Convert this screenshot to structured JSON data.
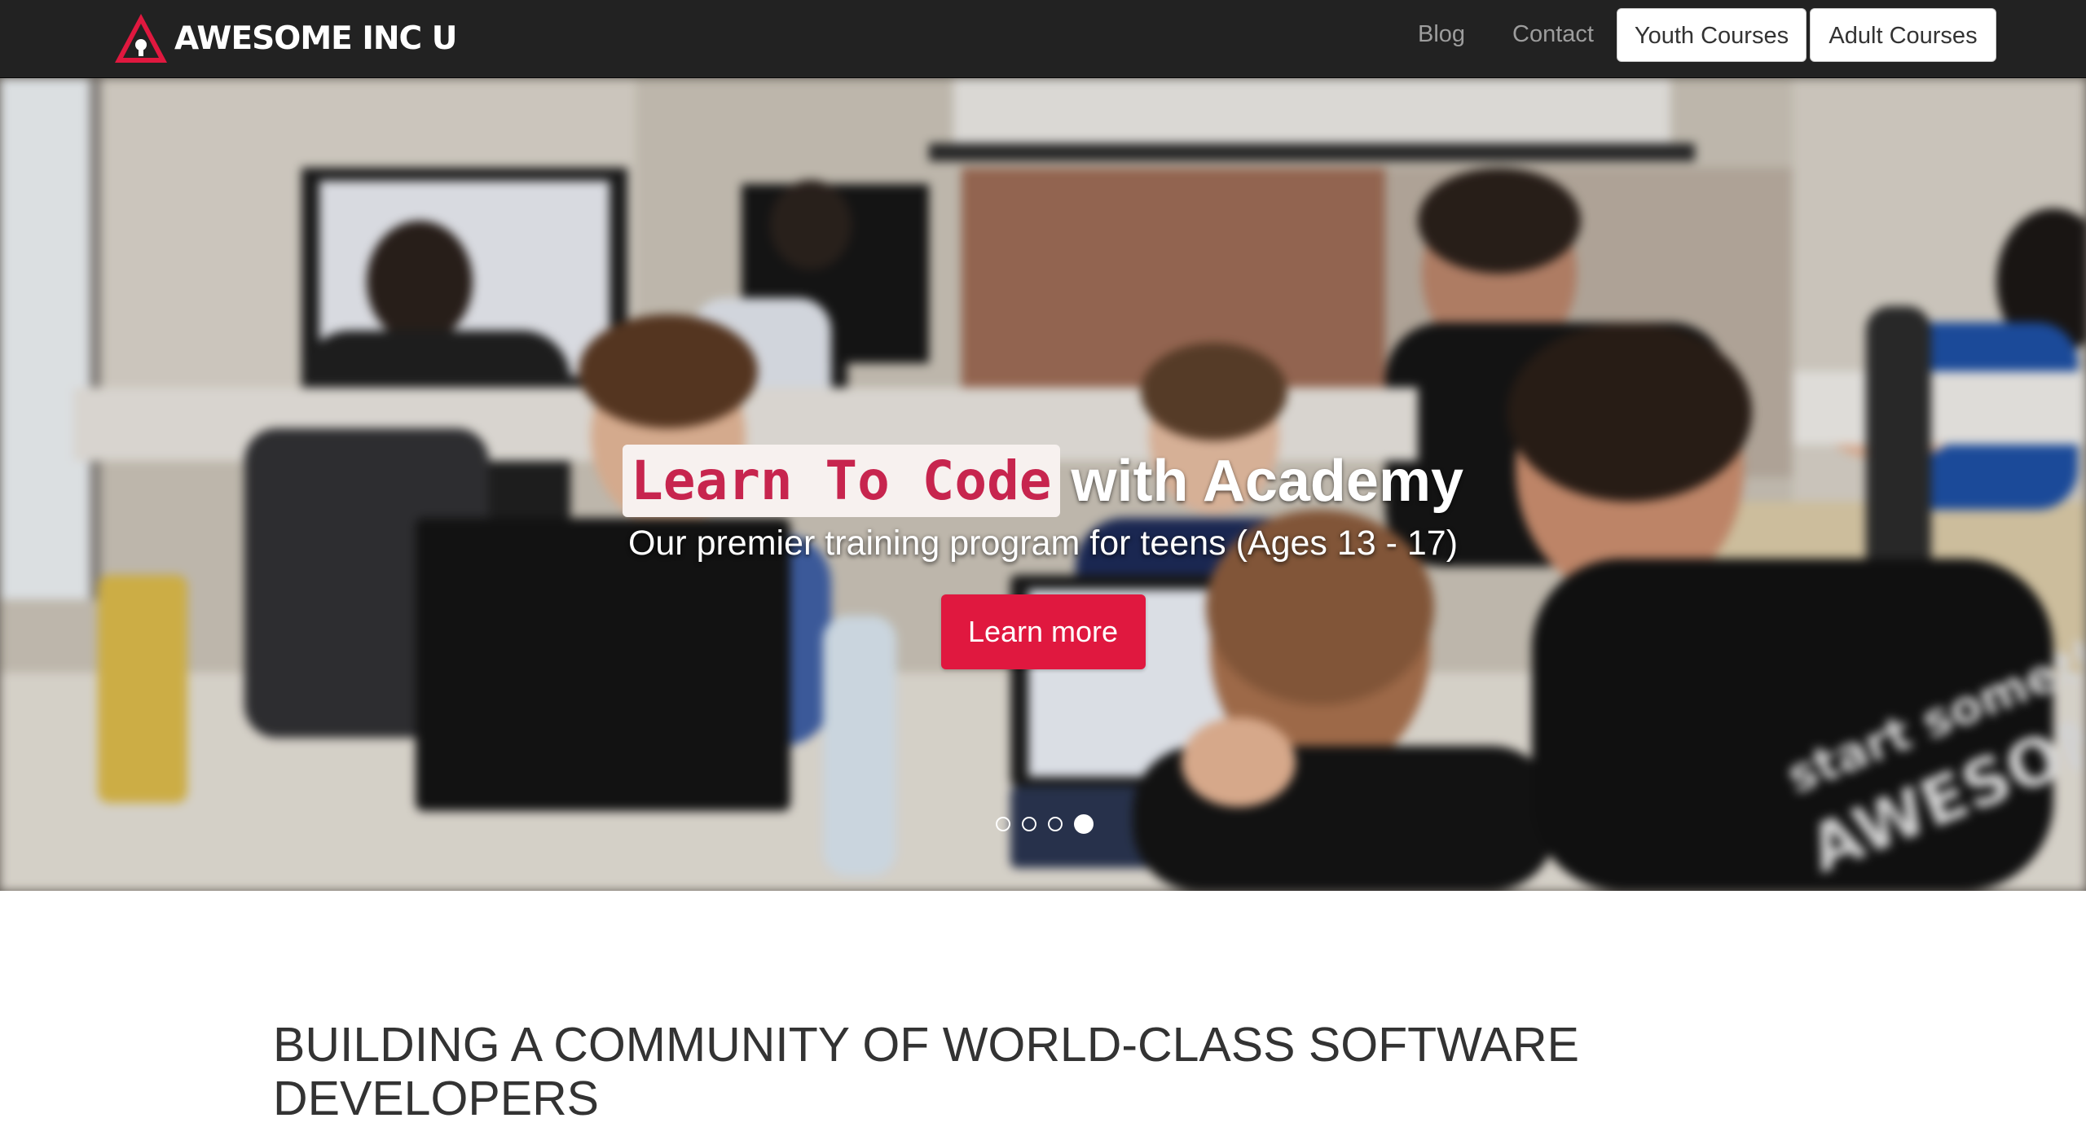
{
  "navbar": {
    "brand": "AWESOME INC U",
    "links": {
      "blog": "Blog",
      "contact": "Contact"
    },
    "buttons": {
      "youth": "Youth Courses",
      "adult": "Adult Courses"
    }
  },
  "hero": {
    "headline_code": "Learn To Code",
    "headline_rest": "with Academy",
    "subheadline": "Our premier training program for teens (Ages 13 - 17)",
    "cta_label": "Learn more",
    "slide_count": 4,
    "active_slide": 4
  },
  "main": {
    "heading": "BUILDING A COMMUNITY OF WORLD-CLASS SOFTWARE DEVELOPERS"
  },
  "colors": {
    "navbar_bg": "#222222",
    "nav_link": "#9d9d9d",
    "cta_red": "#e0183f",
    "code_text": "#c7254e",
    "code_bg": "#f7f1ef",
    "logo_red": "#e0183f",
    "heading_text": "#333333"
  },
  "icons": {
    "logo": "red-triangle-lightbulb-logo"
  }
}
